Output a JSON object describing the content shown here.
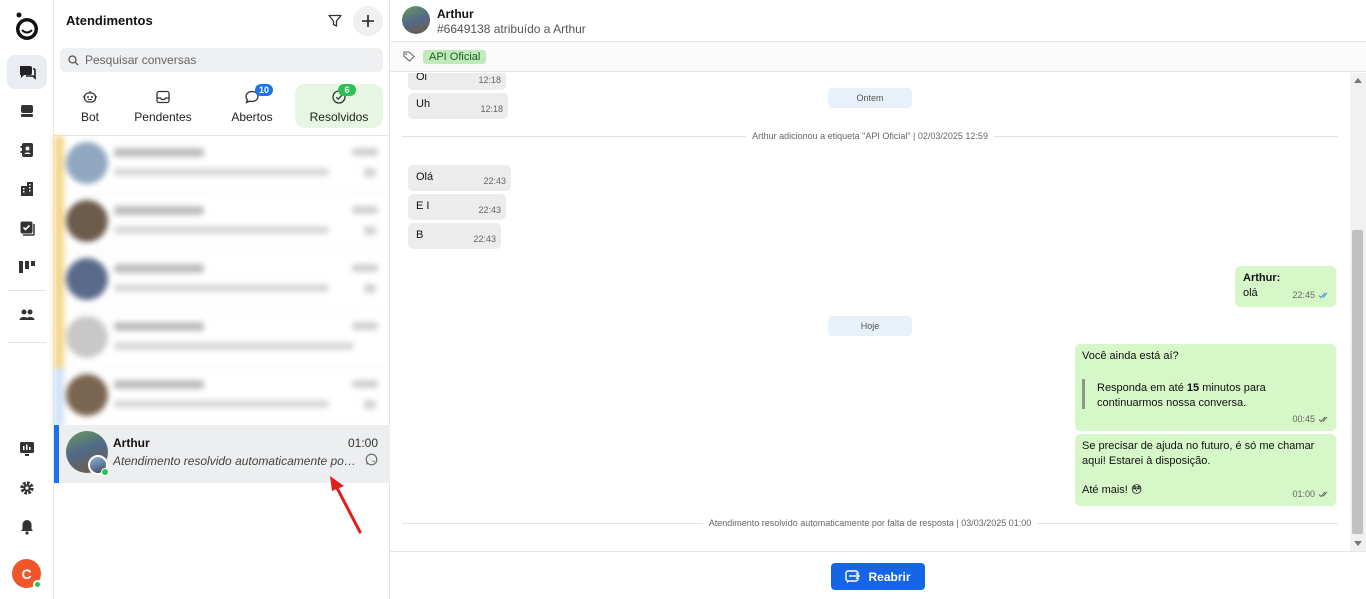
{
  "sidebar_rail": {
    "items": [
      {
        "name": "chat-icon",
        "active": true
      },
      {
        "name": "inbox-icon",
        "active": false
      },
      {
        "name": "contacts-icon",
        "active": false
      },
      {
        "name": "building-icon",
        "active": false
      },
      {
        "name": "tasks-icon",
        "active": false
      },
      {
        "name": "kanban-icon",
        "active": false
      },
      {
        "name": "team-icon",
        "active": false
      },
      {
        "name": "dashboard-icon",
        "active": false
      },
      {
        "name": "gear-icon",
        "active": false
      },
      {
        "name": "bell-icon",
        "active": false
      }
    ],
    "user_initial": "C"
  },
  "list_panel": {
    "title": "Atendimentos",
    "search_placeholder": "Pesquisar conversas",
    "tabs": [
      {
        "label": "Bot",
        "icon": "bot-icon",
        "badge": null
      },
      {
        "label": "Pendentes",
        "icon": "inbox-icon",
        "badge": null
      },
      {
        "label": "Abertos",
        "icon": "chat-bubble-icon",
        "badge": "10"
      },
      {
        "label": "Resolvidos",
        "icon": "check-circle-icon",
        "badge": "6"
      }
    ],
    "active_conversation": {
      "name": "Arthur",
      "time": "01:00",
      "preview": "Atendimento resolvido automaticamente por falta de resposta"
    }
  },
  "chat": {
    "contact_name": "Arthur",
    "subtitle": "#6649138 atribuído a Arthur",
    "tag": "API Oficial",
    "messages": {
      "in_oi": {
        "text": "Oi",
        "time": "12:18"
      },
      "in_uh": {
        "text": "Uh",
        "time": "12:18"
      },
      "day_ontem": "Ontem",
      "sys_tag": "Arthur adicionou a etiqueta \"API Oficial\" | 02/03/2025 12:59",
      "in_ola": {
        "text": "Olá",
        "time": "22:43"
      },
      "in_ei": {
        "text": "E I",
        "time": "22:43"
      },
      "in_b": {
        "text": "B",
        "time": "22:43"
      },
      "out_ola": {
        "sender": "Arthur:",
        "text": "olá",
        "time": "22:45"
      },
      "day_hoje": "Hoje",
      "out_ainda": {
        "line1": "Você ainda está aí?",
        "quote_a": "Responda em até ",
        "quote_bold": "15",
        "quote_b": " minutos para",
        "quote_c": "continuarmos nossa conversa.",
        "time": "00:45"
      },
      "out_ajuda": {
        "line1": "Se precisar de ajuda no futuro, é só me chamar",
        "line2": "aqui! Estarei à disposição.",
        "line3": "Até mais! 😳",
        "time": "01:00"
      },
      "sys_resolved": "Atendimento resolvido automaticamente por falta de resposta | 03/03/2025 01:00"
    },
    "reopen_button": "Reabrir"
  },
  "colors": {
    "accent_blue": "#1565e6",
    "outgoing_bubble": "#d6f7c8",
    "incoming_bubble": "#ececec",
    "badge_blue": "#1a73e8",
    "badge_green": "#2fbf57"
  }
}
